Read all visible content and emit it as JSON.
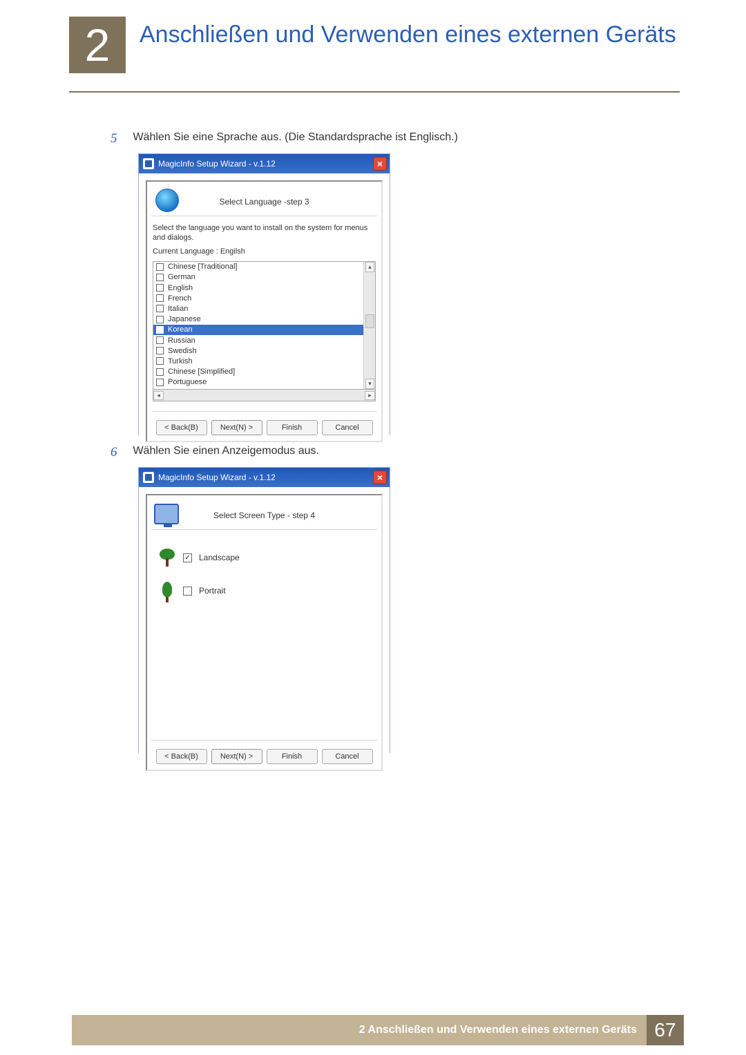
{
  "header": {
    "chapter_number": "2",
    "chapter_title": "Anschließen und Verwenden eines externen Geräts"
  },
  "step5": {
    "num": "5",
    "text": "Wählen Sie eine Sprache aus. (Die Standardsprache ist Englisch.)"
  },
  "step6": {
    "num": "6",
    "text": "Wählen Sie einen Anzeigemodus aus."
  },
  "wizard": {
    "title": "MagicInfo Setup Wizard - v.1.12",
    "close": "×",
    "buttons": {
      "back": "< Back(B)",
      "next": "Next(N) >",
      "finish": "Finish",
      "cancel": "Cancel"
    }
  },
  "lang_panel": {
    "step_title": "Select Language -step 3",
    "desc": "Select the language you want to install on the system for menus and dialogs.",
    "current_label": "Current Language    :    Engilsh",
    "items": [
      "Chinese [Traditional]",
      "German",
      "English",
      "French",
      "Italian",
      "Japanese",
      "Korean",
      "Russian",
      "Swedish",
      "Turkish",
      "Chinese [Simplified]",
      "Portuguese"
    ],
    "selected_index": 6
  },
  "screen_panel": {
    "step_title": "Select Screen Type - step 4",
    "landscape": "Landscape",
    "portrait": "Portrait"
  },
  "footer": {
    "text": "2 Anschließen und Verwenden eines externen Geräts",
    "page": "67"
  }
}
